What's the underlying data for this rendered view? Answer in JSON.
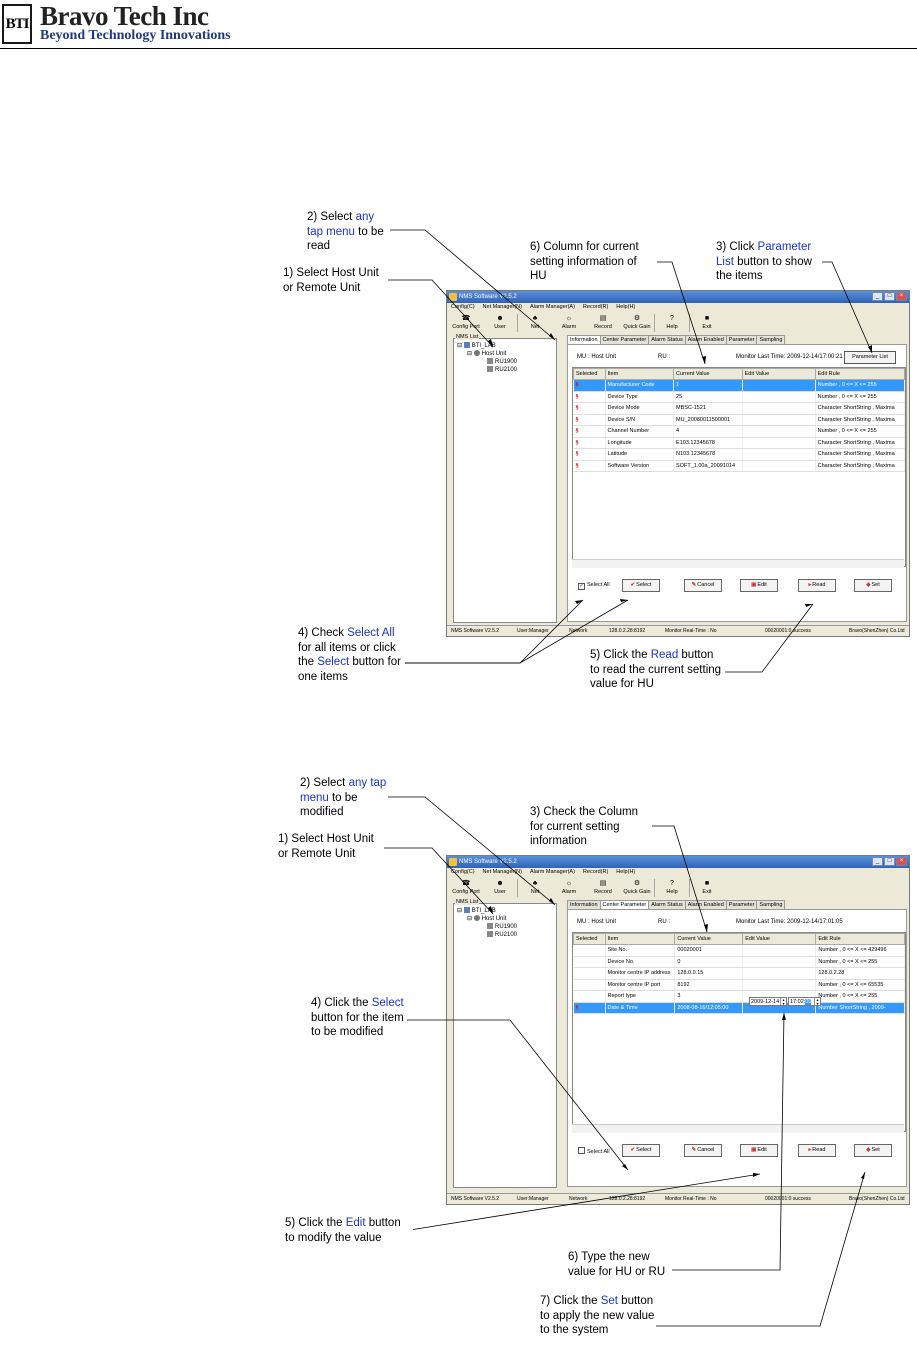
{
  "header": {
    "logo_mark": "BTI",
    "company": "Bravo Tech Inc",
    "tagline": "Beyond Technology Innovations"
  },
  "app": {
    "title": "NMS Software V2.5.2",
    "menu": [
      "Config(C)",
      "Net Manager(N)",
      "Alarm Manager(A)",
      "Record(R)",
      "Help(H)"
    ],
    "toolbar": [
      {
        "label": "Config Port",
        "icon": "port-icon"
      },
      {
        "label": "User",
        "icon": "user-icon"
      },
      {
        "label": "Net",
        "icon": "net-icon"
      },
      {
        "label": "Alarm",
        "icon": "alarm-icon"
      },
      {
        "label": "Record",
        "icon": "record-icon"
      },
      {
        "label": "Quick Gain",
        "icon": "gain-icon"
      },
      {
        "label": "Help",
        "icon": "help-icon"
      },
      {
        "label": "Exit",
        "icon": "exit-icon"
      }
    ],
    "tree": {
      "label": "NMS List",
      "root": "BTI_LAB",
      "host": "Host Unit",
      "children": [
        "RU1900",
        "RU2100"
      ]
    },
    "tabs": [
      "Information",
      "Center Parameter",
      "Alarm Status",
      "Alarm Enabled",
      "Parameter",
      "Sampling"
    ],
    "status": {
      "version": "NMS Software V2.5.2",
      "user": "User:Manager",
      "network": "Network",
      "address": "128.0.2.28:8192",
      "monitor": "Monitor Real-Time : No",
      "result": "00020001:0 success",
      "company": "Bravo(ShenZhen) Co.Ltd"
    },
    "columns": [
      "Selected",
      "Item",
      "Current Value",
      "Edit Value",
      "Edit Rule"
    ],
    "buttons": {
      "select_all": "Select All",
      "select": "Select",
      "cancel": "Cancel",
      "edit": "Edit",
      "read": "Read",
      "set": "Set"
    }
  },
  "screen1": {
    "mu": "MU : Host Unit",
    "ru": "RU :",
    "monitor_time": "Monitor Last Time: 2009-12-14/17:00:21",
    "param_list_button": "Parameter List",
    "active_tab": 0,
    "rows": [
      {
        "item": "Manufacturer Code",
        "value": "1",
        "edit": "",
        "rule": "Number , 0 <= X <= 255",
        "selected": true
      },
      {
        "item": "Device Type",
        "value": "25",
        "edit": "",
        "rule": "Number , 0 <= X <= 255",
        "selected": false
      },
      {
        "item": "Device Mode",
        "value": "MBSC-1521",
        "edit": "",
        "rule": "Character ShortString , Maxima",
        "selected": false
      },
      {
        "item": "Device S/N",
        "value": "MU_20080011500001",
        "edit": "",
        "rule": "Character ShortString , Maxima",
        "selected": false
      },
      {
        "item": "Channel Number",
        "value": "4",
        "edit": "",
        "rule": "Number , 0 <= X <= 255",
        "selected": false
      },
      {
        "item": "Longitude",
        "value": "E103.12345678",
        "edit": "",
        "rule": "Character ShortString , Maxima",
        "selected": false
      },
      {
        "item": "Latitude",
        "value": "N103.12345678",
        "edit": "",
        "rule": "Character ShortString , Maxima",
        "selected": false
      },
      {
        "item": "Software Version",
        "value": "SOFT_1.00a_20091014",
        "edit": "",
        "rule": "Character ShortString , Maxima",
        "selected": false
      }
    ],
    "callouts": {
      "c2": {
        "pre": "2) Select ",
        "hl": "any tap menu",
        "post": " to be read"
      },
      "c1": {
        "text": "1) Select Host Unit or Remote Unit"
      },
      "c6": {
        "text": "6) Column for current setting information of HU"
      },
      "c3": {
        "pre": "3) Click ",
        "hl": "Parameter List",
        "post": " button to show the items"
      },
      "c4": {
        "pre": "4) Check ",
        "hl": "Select All",
        "mid": " for all items or click the ",
        "hl2": "Select",
        "post": " button for one items"
      },
      "c5": {
        "pre": "5) Click the ",
        "hl": "Read",
        "post": " button to read the current setting value for HU"
      }
    }
  },
  "screen2": {
    "mu": "MU : Host Unit",
    "ru": "RU :",
    "monitor_time": "Monitor Last Time: 2009-12-14/17:01:05",
    "active_tab": 1,
    "rows": [
      {
        "item": "Site No.",
        "value": "00020001",
        "edit": "",
        "rule": "Number , 0 <= X <= 429496",
        "selected": false
      },
      {
        "item": "Device No.",
        "value": "0",
        "edit": "",
        "rule": "Number , 0 <= X <= 255",
        "selected": false
      },
      {
        "item": "Monitor centre IP address",
        "value": "128.0.0.15",
        "edit": "",
        "rule": "128.0.2.28",
        "selected": false
      },
      {
        "item": "Monitor centre IP port",
        "value": "8192",
        "edit": "",
        "rule": "Number , 0 <= X <= 65535",
        "selected": false
      },
      {
        "item": "Report type",
        "value": "3",
        "edit": "",
        "rule": "Number , 0 <= X <= 255",
        "selected": false
      },
      {
        "item": "Date & Time",
        "value": "2008-08-16/12:05:00",
        "edit": "",
        "rule": "Number ShortString , 2009-",
        "selected": true
      }
    ],
    "edit_date": "2009-12-14",
    "edit_time": "17:02:",
    "edit_sec": "00",
    "callouts": {
      "c2": {
        "pre": "2) Select ",
        "hl": "any tap menu",
        "post": " to be modified"
      },
      "c1": {
        "text": "1) Select Host Unit or Remote Unit"
      },
      "c3": {
        "text": "3) Check the Column for current setting information"
      },
      "c4": {
        "pre": "4) Click the ",
        "hl": "Select",
        "post": " button for the item to be modified"
      },
      "c5": {
        "pre": "5) Click the ",
        "hl": "Edit",
        "post": " button to modify the value"
      },
      "c6": {
        "text": "6) Type the new value for HU or RU"
      },
      "c7": {
        "pre": "7) Click the ",
        "hl": "Set",
        "post": " button to apply the new value to the system"
      }
    }
  }
}
